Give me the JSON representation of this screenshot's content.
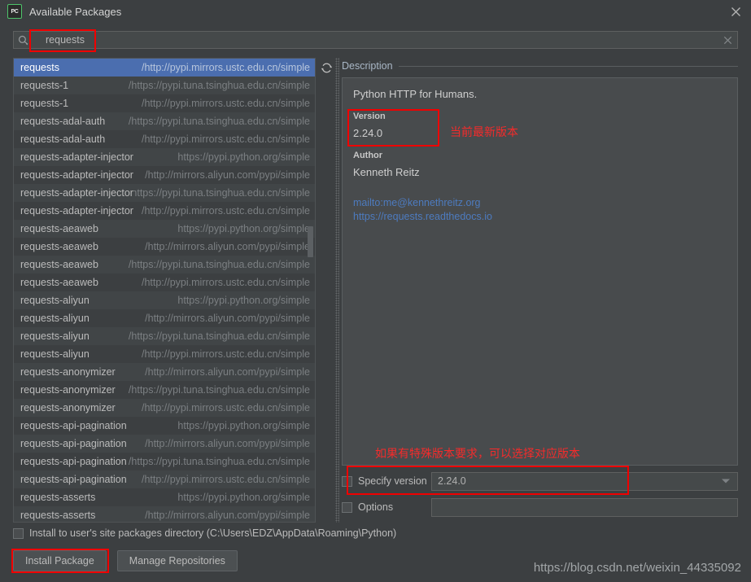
{
  "window": {
    "app_icon": "pycharm-icon",
    "app_icon_text": "PC",
    "title": "Available Packages",
    "close_icon": "close-icon"
  },
  "search": {
    "icon": "search-icon",
    "value": "requests",
    "placeholder": "",
    "clear_icon": "close-icon"
  },
  "toolbar": {
    "refresh_icon": "refresh-icon"
  },
  "packages": [
    {
      "name": "requests",
      "url": "http://pypi.mirrors.ustc.edu.cn/simple/",
      "selected": true
    },
    {
      "name": "requests-1",
      "url": "https://pypi.tuna.tsinghua.edu.cn/simple/",
      "selected": false
    },
    {
      "name": "requests-1",
      "url": "http://pypi.mirrors.ustc.edu.cn/simple/",
      "selected": false
    },
    {
      "name": "requests-adal-auth",
      "url": "https://pypi.tuna.tsinghua.edu.cn/simple/",
      "selected": false
    },
    {
      "name": "requests-adal-auth",
      "url": "http://pypi.mirrors.ustc.edu.cn/simple/",
      "selected": false
    },
    {
      "name": "requests-adapter-injector",
      "url": "https://pypi.python.org/simple",
      "selected": false
    },
    {
      "name": "requests-adapter-injector",
      "url": "http://mirrors.aliyun.com/pypi/simple/",
      "selected": false
    },
    {
      "name": "requests-adapter-injector",
      "url": "https://pypi.tuna.tsinghua.edu.cn/simple/",
      "selected": false
    },
    {
      "name": "requests-adapter-injector",
      "url": "http://pypi.mirrors.ustc.edu.cn/simple/",
      "selected": false
    },
    {
      "name": "requests-aeaweb",
      "url": "https://pypi.python.org/simple",
      "selected": false
    },
    {
      "name": "requests-aeaweb",
      "url": "http://mirrors.aliyun.com/pypi/simple/",
      "selected": false
    },
    {
      "name": "requests-aeaweb",
      "url": "https://pypi.tuna.tsinghua.edu.cn/simple/",
      "selected": false
    },
    {
      "name": "requests-aeaweb",
      "url": "http://pypi.mirrors.ustc.edu.cn/simple/",
      "selected": false
    },
    {
      "name": "requests-aliyun",
      "url": "https://pypi.python.org/simple",
      "selected": false
    },
    {
      "name": "requests-aliyun",
      "url": "http://mirrors.aliyun.com/pypi/simple/",
      "selected": false
    },
    {
      "name": "requests-aliyun",
      "url": "https://pypi.tuna.tsinghua.edu.cn/simple/",
      "selected": false
    },
    {
      "name": "requests-aliyun",
      "url": "http://pypi.mirrors.ustc.edu.cn/simple/",
      "selected": false
    },
    {
      "name": "requests-anonymizer",
      "url": "http://mirrors.aliyun.com/pypi/simple/",
      "selected": false
    },
    {
      "name": "requests-anonymizer",
      "url": "https://pypi.tuna.tsinghua.edu.cn/simple/",
      "selected": false
    },
    {
      "name": "requests-anonymizer",
      "url": "http://pypi.mirrors.ustc.edu.cn/simple/",
      "selected": false
    },
    {
      "name": "requests-api-pagination",
      "url": "https://pypi.python.org/simple",
      "selected": false
    },
    {
      "name": "requests-api-pagination",
      "url": "http://mirrors.aliyun.com/pypi/simple/",
      "selected": false
    },
    {
      "name": "requests-api-pagination",
      "url": "https://pypi.tuna.tsinghua.edu.cn/simple/",
      "selected": false
    },
    {
      "name": "requests-api-pagination",
      "url": "http://pypi.mirrors.ustc.edu.cn/simple/",
      "selected": false
    },
    {
      "name": "requests-asserts",
      "url": "https://pypi.python.org/simple",
      "selected": false
    },
    {
      "name": "requests-asserts",
      "url": "http://mirrors.aliyun.com/pypi/simple/",
      "selected": false
    }
  ],
  "description": {
    "header": "Description",
    "summary": "Python HTTP for Humans.",
    "version_label": "Version",
    "version_value": "2.24.0",
    "author_label": "Author",
    "author_value": "Kenneth Reitz",
    "links": [
      "mailto:me@kennethreitz.org",
      "https://requests.readthedocs.io"
    ]
  },
  "options": {
    "specify_version_label": "Specify version",
    "specify_version_value": "2.24.0",
    "specify_version_checked": false,
    "options_label": "Options",
    "options_value": "",
    "options_checked": false,
    "install_dir_label": "Install to user's site packages directory (C:\\Users\\EDZ\\AppData\\Roaming\\Python)",
    "install_dir_checked": false
  },
  "buttons": {
    "install": "Install Package",
    "manage": "Manage Repositories"
  },
  "annotations": {
    "version_note": "当前最新版本",
    "specify_note": "如果有特殊版本要求，可以选择对应版本",
    "highlight_color": "#f00000"
  },
  "watermark": "https://blog.csdn.net/weixin_44335092"
}
